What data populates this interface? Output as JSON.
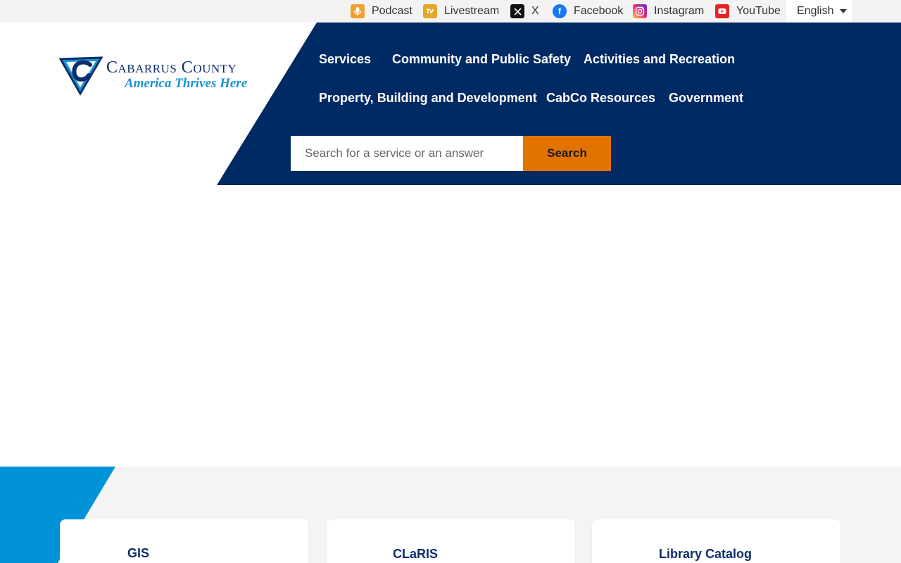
{
  "topbar": {
    "links": [
      {
        "label": "Podcast",
        "icon": "podcast-icon"
      },
      {
        "label": "Livestream",
        "icon": "livestream-icon"
      },
      {
        "label": "X",
        "icon": "x-icon"
      },
      {
        "label": "Facebook",
        "icon": "facebook-icon"
      },
      {
        "label": "Instagram",
        "icon": "instagram-icon"
      },
      {
        "label": "YouTube",
        "icon": "youtube-icon"
      }
    ],
    "language": "English"
  },
  "logo": {
    "name": "Cabarrus County",
    "tagline": "America Thrives Here"
  },
  "nav": {
    "items": [
      "Services",
      "Community and Public Safety",
      "Activities and Recreation",
      "Property, Building and Development",
      "CabCo Resources",
      "Government"
    ]
  },
  "search": {
    "placeholder": "Search for a service or an answer",
    "button_label": "Search"
  },
  "cards": [
    {
      "title": "GIS"
    },
    {
      "title": "CLaRIS"
    },
    {
      "title": "Library Catalog"
    }
  ],
  "colors": {
    "navy": "#002a63",
    "orange": "#e27300",
    "accent_blue": "#0093d8",
    "topbar_bg": "#f3f3f3",
    "lower_bg": "#f4f4f4"
  }
}
